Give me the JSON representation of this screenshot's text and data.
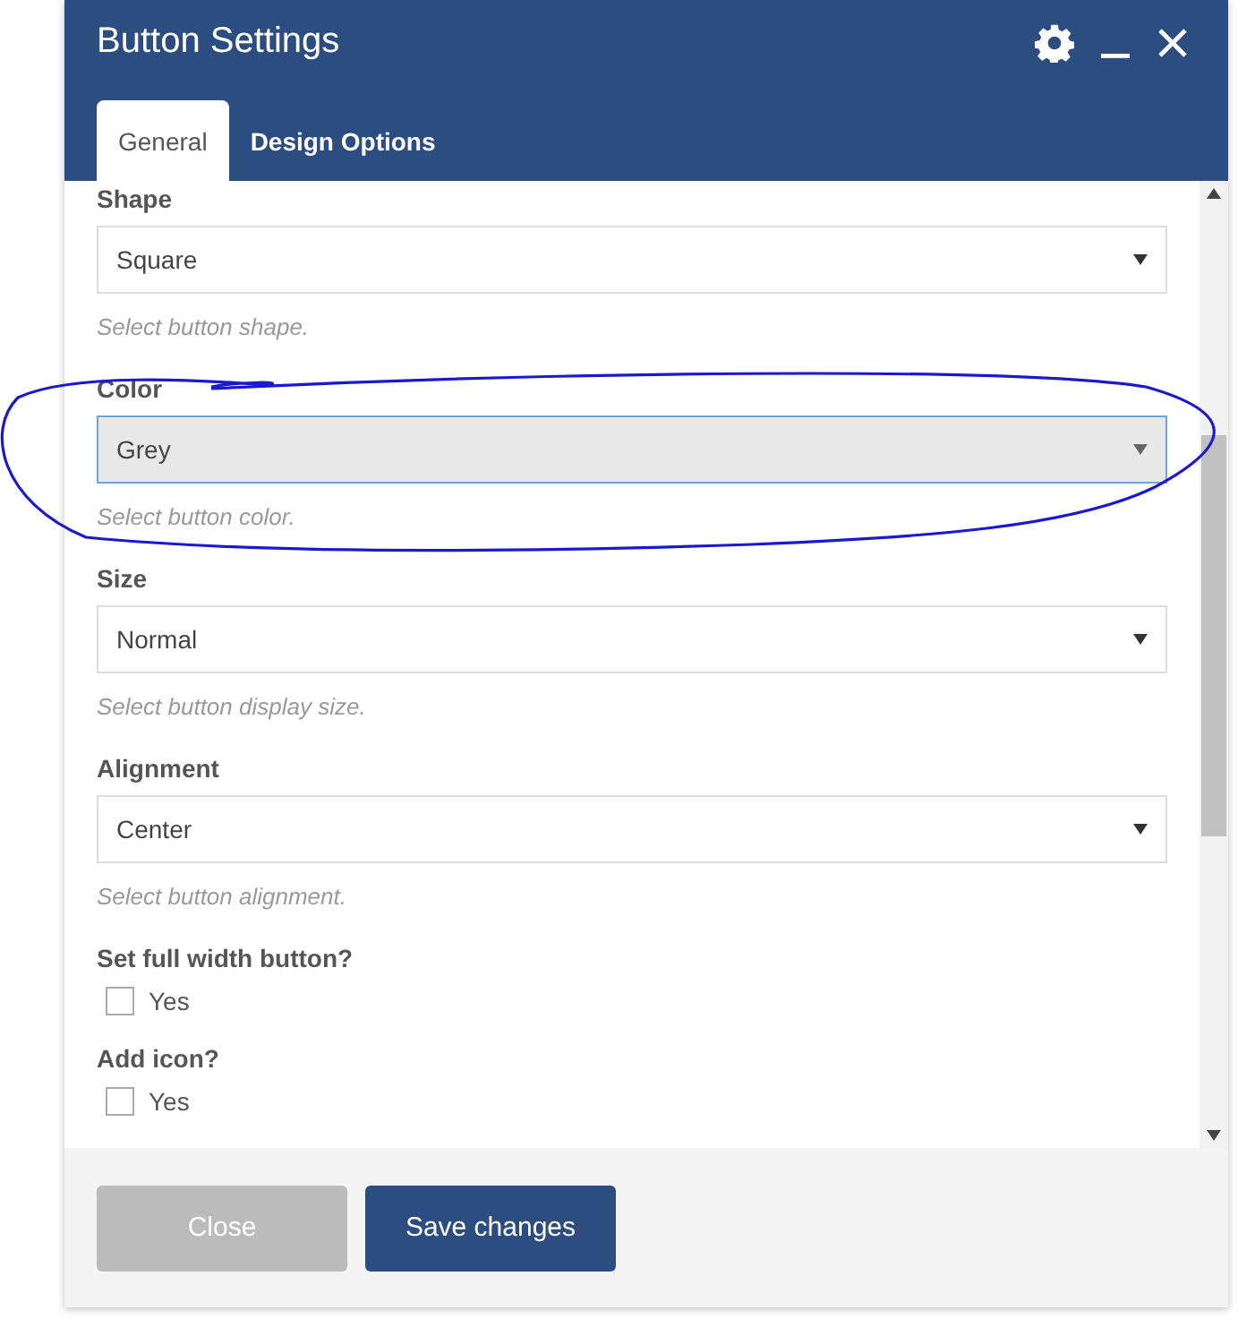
{
  "dialog": {
    "title": "Button Settings"
  },
  "tabs": [
    {
      "label": "General",
      "selected": true
    },
    {
      "label": "Design Options",
      "selected": false
    }
  ],
  "fields": [
    {
      "kind": "select",
      "label": "Shape",
      "value": "Square",
      "help": "Select button shape.",
      "focused": false
    },
    {
      "kind": "select",
      "label": "Color",
      "value": "Grey",
      "help": "Select button color.",
      "focused": true
    },
    {
      "kind": "select",
      "label": "Size",
      "value": "Normal",
      "help": "Select button display size.",
      "focused": false
    },
    {
      "kind": "select",
      "label": "Alignment",
      "value": "Center",
      "help": "Select button alignment.",
      "focused": false
    },
    {
      "kind": "checkbox",
      "label": "Set full width button?",
      "option": "Yes",
      "checked": false
    },
    {
      "kind": "checkbox",
      "label": "Add icon?",
      "option": "Yes",
      "checked": false
    }
  ],
  "buttons": [
    {
      "label": "Close",
      "kind": "secondary"
    },
    {
      "label": "Save changes",
      "kind": "primary"
    }
  ]
}
